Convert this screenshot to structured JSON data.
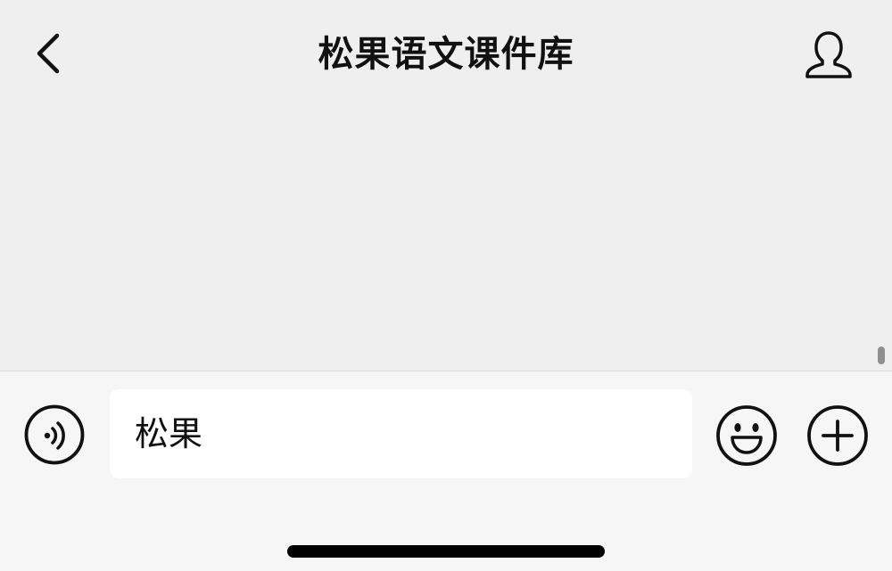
{
  "header": {
    "title": "松果语文课件库",
    "back_icon": "chevron-left-icon",
    "profile_icon": "person-icon"
  },
  "input_bar": {
    "voice_icon": "voice-input-icon",
    "message_value": "松果",
    "emoji_icon": "smiley-icon",
    "more_icon": "plus-circle-icon"
  },
  "colors": {
    "background": "#efefef",
    "input_bar_background": "#f6f6f6",
    "input_field_background": "#ffffff",
    "icon_color": "#111111",
    "home_indicator": "#000000"
  }
}
